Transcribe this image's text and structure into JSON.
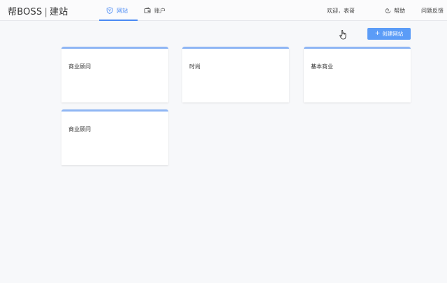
{
  "header": {
    "logo_brand": "帮BOSS",
    "logo_separator": "|",
    "logo_product": "建站",
    "tabs": [
      {
        "label": "网站",
        "icon": "website-icon",
        "active": true
      },
      {
        "label": "账户",
        "icon": "wallet-icon",
        "active": false
      }
    ],
    "greeting": "欢迎，表哥",
    "help_label": "帮助",
    "feedback_label": "问题反馈"
  },
  "toolbar": {
    "create_label": "创建网站",
    "create_icon": "plus-icon"
  },
  "sites": [
    {
      "name": "商业顾问"
    },
    {
      "name": "时尚"
    },
    {
      "name": "基本商业"
    },
    {
      "name": "商业顾问"
    }
  ],
  "colors": {
    "accent": "#4a8af4",
    "button": "#5b9cf7",
    "card_top": "#8fb6f4",
    "background": "#f7f8fa"
  }
}
